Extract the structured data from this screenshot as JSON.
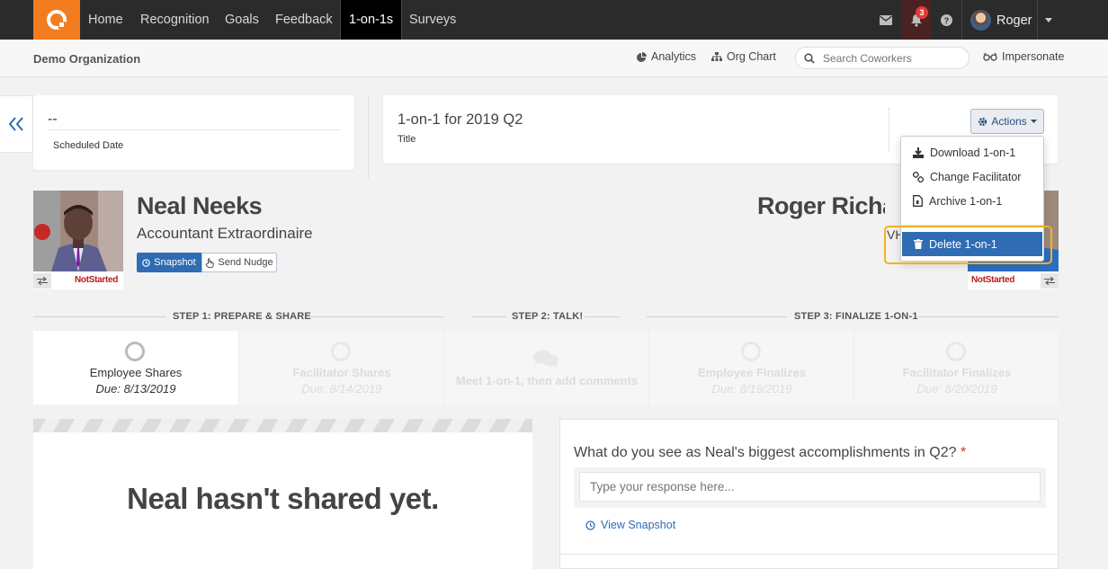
{
  "nav": {
    "items": [
      "Home",
      "Recognition",
      "Goals",
      "Feedback",
      "1-on-1s",
      "Surveys"
    ],
    "active": "1-on-1s",
    "notification_count": "3",
    "user_name": "Roger"
  },
  "subheader": {
    "org_name": "Demo Organization",
    "analytics_label": "Analytics",
    "org_chart_label": "Org Chart",
    "search_placeholder": "Search Coworkers",
    "impersonate_label": "Impersonate"
  },
  "date_card": {
    "value": "--",
    "label": "Scheduled Date"
  },
  "title_card": {
    "value": "1-on-1 for 2019 Q2",
    "label": "Title",
    "actions_label": "Actions"
  },
  "actions_menu": {
    "download": "Download 1-on-1",
    "change_facilitator": "Change Facilitator",
    "archive": "Archive 1-on-1",
    "delete": "Delete 1-on-1"
  },
  "employee": {
    "name": "Neal Neeks",
    "title": "Accountant Extraordinaire",
    "status": "NotStarted",
    "snapshot_label": "Snapshot",
    "nudge_label": "Send Nudge"
  },
  "facilitator": {
    "name": "Roger Richar",
    "title_fragment": "VH",
    "status": "NotStarted"
  },
  "steps": {
    "headers": [
      "STEP 1: PREPARE & SHARE",
      "STEP 2: TALK!",
      "STEP 3: FINALIZE 1-ON-1"
    ],
    "cells": [
      {
        "label": "Employee Shares",
        "due": "Due: 8/13/2019"
      },
      {
        "label": "Facilitator Shares",
        "due": "Due: 8/14/2019"
      },
      {
        "label": "Meet 1-on-1, then add comments",
        "due": ""
      },
      {
        "label": "Employee Finalizes",
        "due": "Due: 8/19/2019"
      },
      {
        "label": "Facilitator Finalizes",
        "due": "Due: 8/20/2019"
      }
    ]
  },
  "share": {
    "message": "Neal hasn't shared yet."
  },
  "question": {
    "text": "What do you see as Neal's biggest accomplishments in Q2?",
    "required_mark": "*",
    "placeholder": "Type your response here...",
    "view_snapshot": "View Snapshot"
  },
  "colors": {
    "brand": "#f47c20",
    "primary": "#2f6cb3",
    "danger_text": "#b71c1c",
    "highlight": "#f2b21f"
  }
}
